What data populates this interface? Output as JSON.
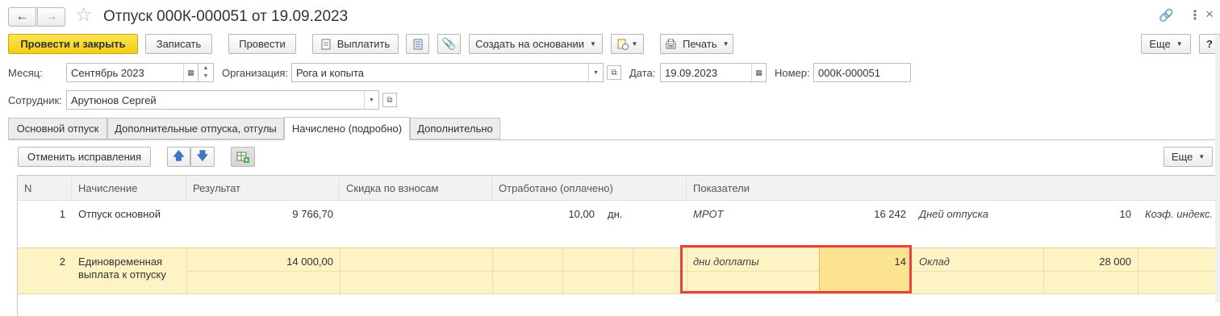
{
  "window": {
    "title": "Отпуск 000К-000051 от 19.09.2023"
  },
  "toolbar": {
    "post_close": "Провести и закрыть",
    "save": "Записать",
    "post": "Провести",
    "pay": "Выплатить",
    "create_based": "Создать на основании",
    "print": "Печать",
    "more": "Еще",
    "help": "?"
  },
  "form": {
    "month_label": "Месяц:",
    "month_value": "Сентябрь 2023",
    "org_label": "Организация:",
    "org_value": "Рога и копыта",
    "date_label": "Дата:",
    "date_value": "19.09.2023",
    "number_label": "Номер:",
    "number_value": "000К-000051",
    "employee_label": "Сотрудник:",
    "employee_value": "Арутюнов Сергей"
  },
  "tabs": [
    "Основной отпуск",
    "Дополнительные отпуска, отгулы",
    "Начислено (подробно)",
    "Дополнительно"
  ],
  "table_toolbar": {
    "cancel_fix": "Отменить исправления",
    "more": "Еще"
  },
  "table": {
    "columns": [
      "N",
      "Начисление",
      "Результат",
      "Скидка по взносам",
      "Отработано (оплачено)",
      "Показатели"
    ],
    "rows": [
      {
        "n": "1",
        "accrual": "Отпуск основной",
        "accrual_line2": "",
        "result": "9 766,70",
        "worked": "10,00",
        "worked_unit": "дн.",
        "ind1_name": "МРОТ",
        "ind1_value": "16 242",
        "ind2_name": "Дней отпуска",
        "ind2_value": "10",
        "ind3_name": "Коэф. индекс."
      },
      {
        "n": "2",
        "accrual": "Единовременная",
        "accrual_line2": "выплата к отпуску",
        "result": "14 000,00",
        "worked": "",
        "worked_unit": "",
        "ind1_name": "дни доплаты",
        "ind1_value": "14",
        "ind2_name": "Оклад",
        "ind2_value": "28 000",
        "ind3_name": ""
      }
    ]
  },
  "colors": {
    "primary_button": "#f2cd12",
    "selected_row": "#fdf3c4",
    "selected_cell": "#fbe38f",
    "highlight_frame": "#e8413f"
  }
}
